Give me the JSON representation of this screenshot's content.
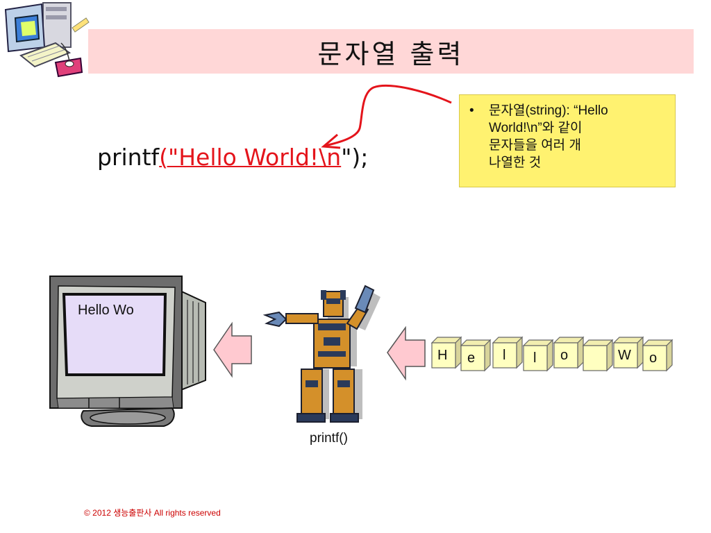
{
  "slide": {
    "title": "문자열 출력",
    "code": {
      "prefix": "printf",
      "argument": "(\"Hello World!\\n",
      "suffix": "\");"
    },
    "callout": {
      "bullet": "•",
      "lines": [
        "문자열(string): “Hello",
        "World!\\n”와 같이",
        "문자들을 여러 개",
        "나열한 것"
      ]
    },
    "monitor_text": "Hello Wo",
    "robot_label": "printf()",
    "letters": [
      "H",
      "e",
      "l",
      "l",
      "o",
      "",
      "W",
      "o"
    ],
    "copyright": "© 2012 생능출판사  All rights reserved"
  },
  "colors": {
    "title_bg": "#ffd7d7",
    "callout_bg": "#fff270",
    "highlight": "#e4141b",
    "arrow_fill": "#ffc9d0",
    "box_fill": "#ffffc0"
  }
}
